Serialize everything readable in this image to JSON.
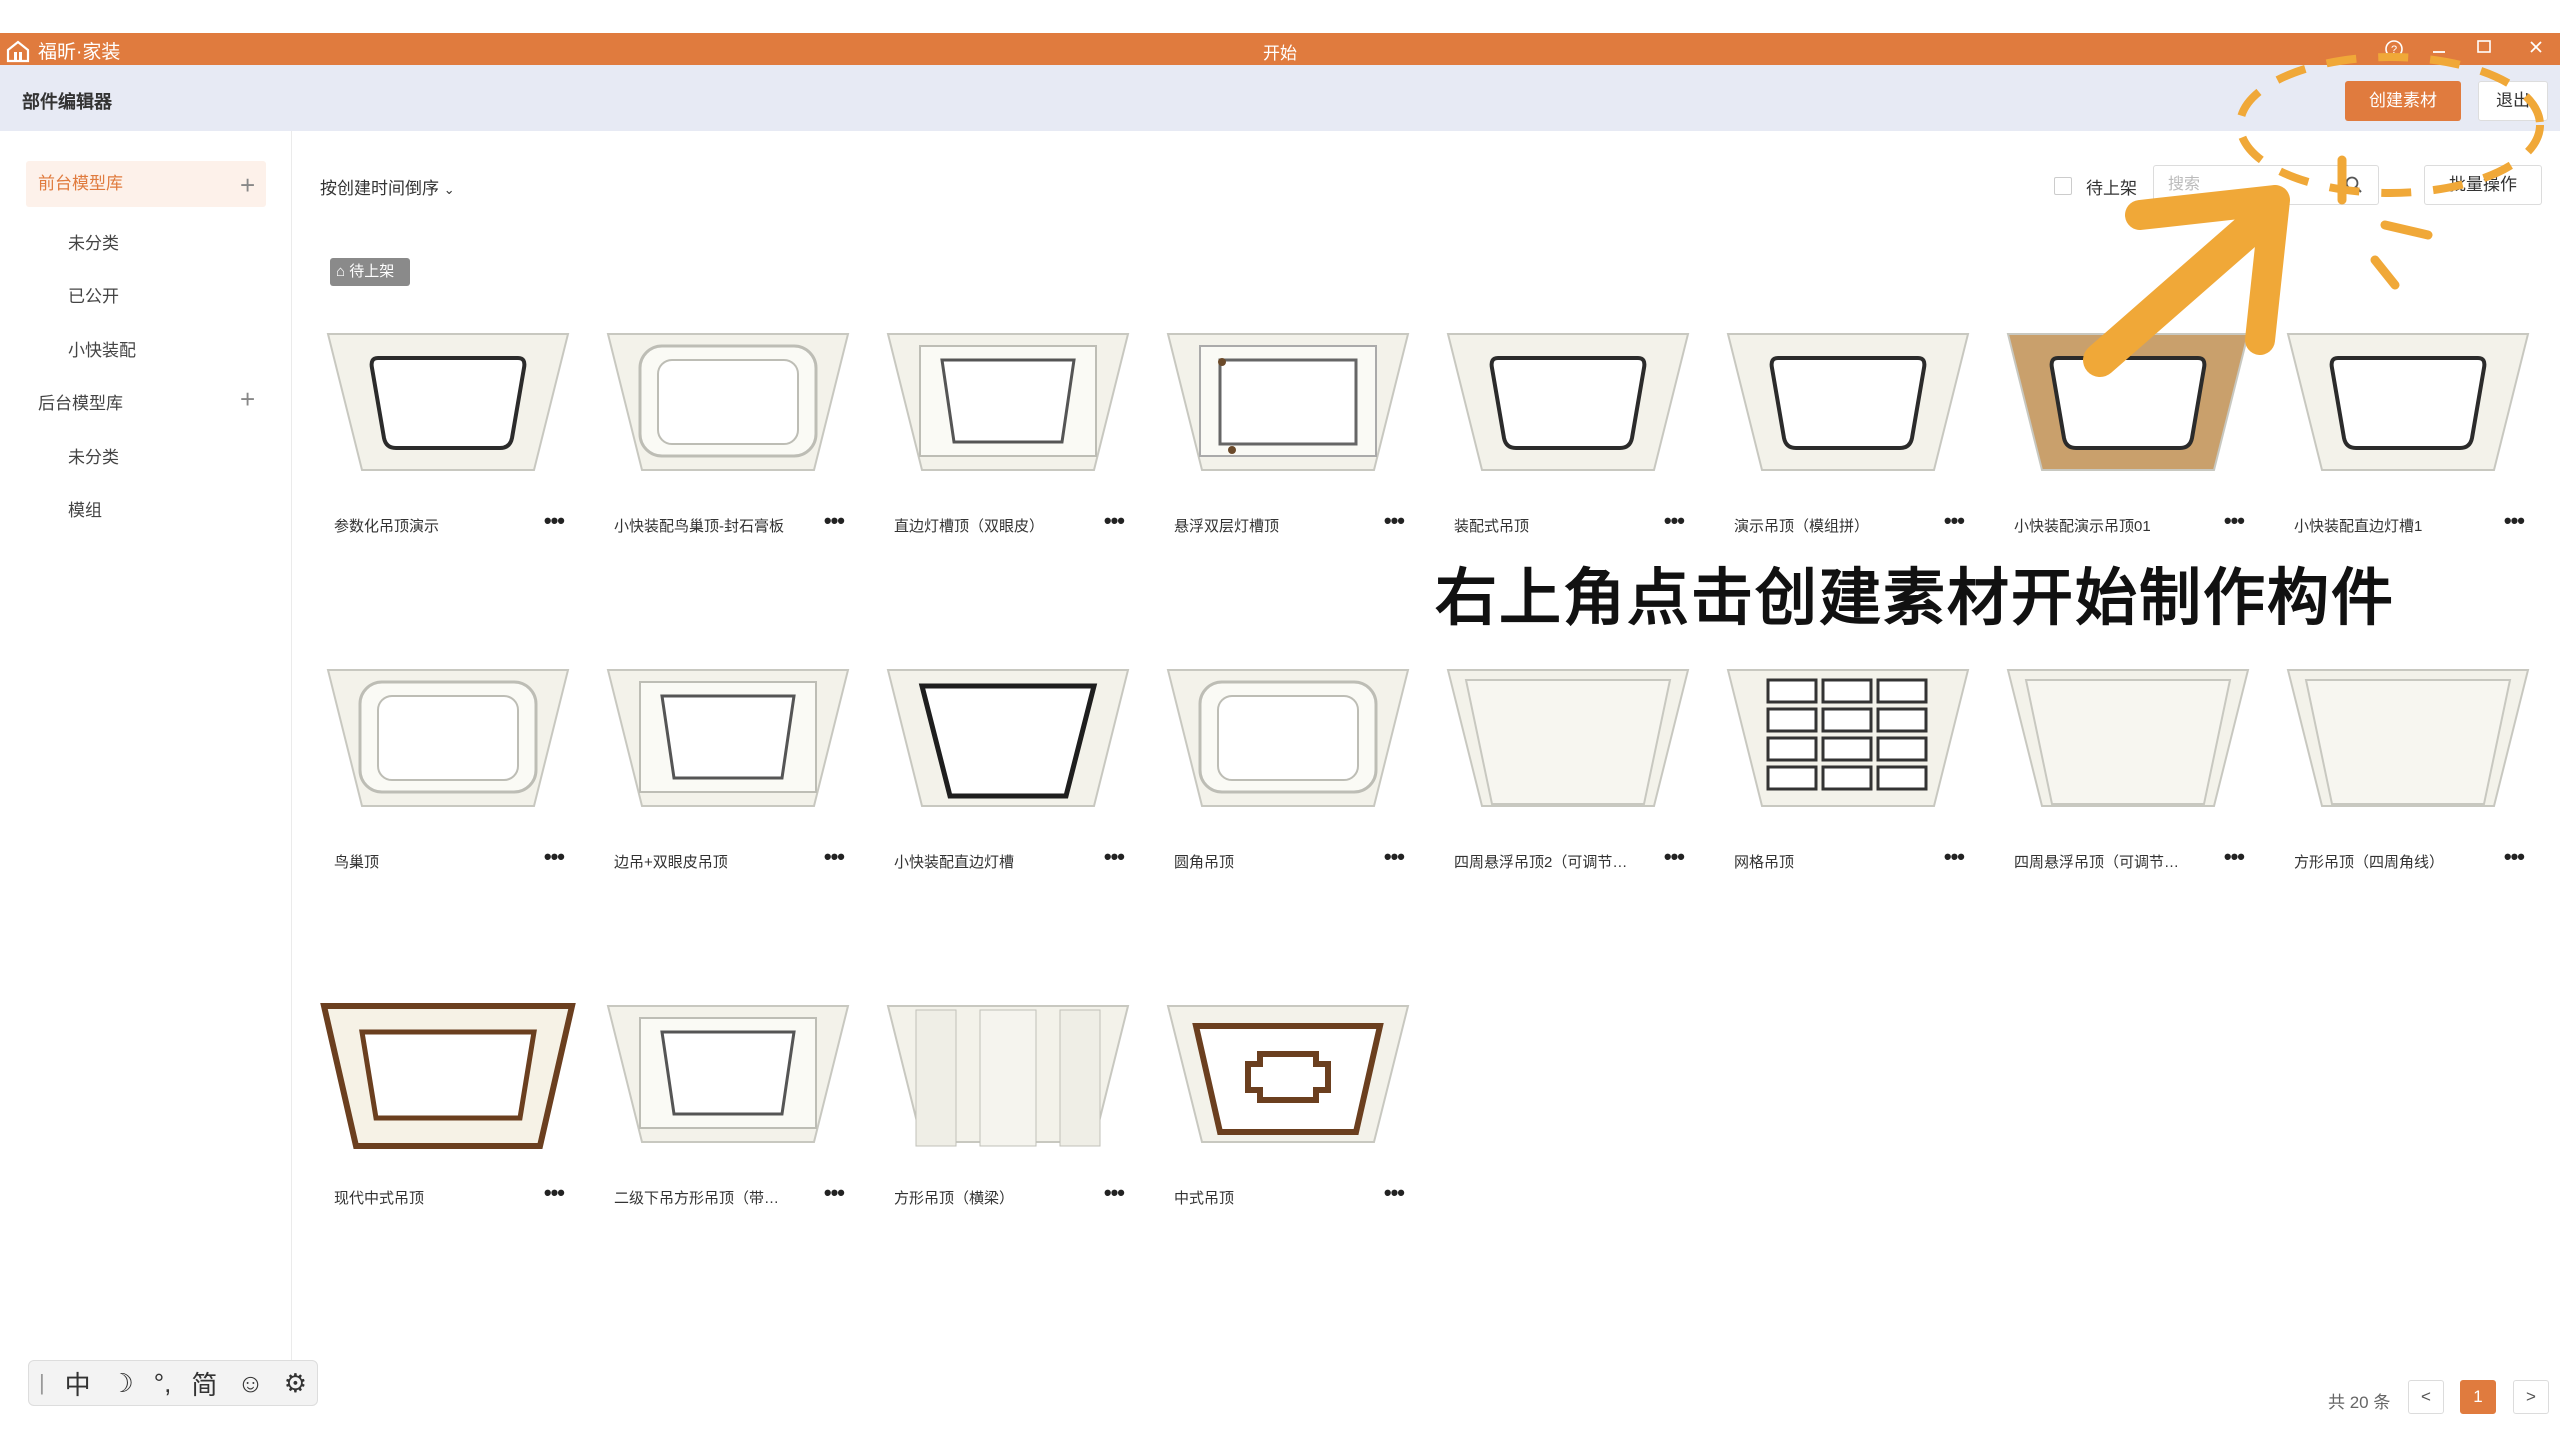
{
  "app": {
    "brand": "福昕·家装",
    "window_title": "开始"
  },
  "header": {
    "page_title": "部件编辑器",
    "create_label": "创建素材",
    "exit_label": "退出"
  },
  "sidebar": {
    "front_lib": "前台模型库",
    "front_items": [
      "未分类",
      "已公开",
      "小快装配"
    ],
    "back_lib": "后台模型库",
    "back_items": [
      "未分类",
      "模组"
    ]
  },
  "toolbar": {
    "sort_label": "按创建时间倒序",
    "pending_label": "待上架",
    "search_placeholder": "搜索",
    "batch_label": "批量操作"
  },
  "badge": "待上架",
  "cards": [
    "参数化吊顶演示",
    "小快装配鸟巢顶-封石膏板",
    "直边灯槽顶（双眼皮）",
    "悬浮双层灯槽顶",
    "装配式吊顶",
    "演示吊顶（模组拼）",
    "小快装配演示吊顶01",
    "小快装配直边灯槽1",
    "鸟巢顶",
    "边吊+双眼皮吊顶",
    "小快装配直边灯槽",
    "圆角吊顶",
    "四周悬浮吊顶2（可调节…",
    "网格吊顶",
    "四周悬浮吊顶（可调节…",
    "方形吊顶（四周角线）",
    "现代中式吊顶",
    "二级下吊方形吊顶（带…",
    "方形吊顶（横梁）",
    "中式吊顶"
  ],
  "more_label": "•••",
  "caption": "右上角点击创建素材开始制作构件",
  "ime": [
    "中",
    "简"
  ],
  "pagination": {
    "total": "共 20 条",
    "current": "1",
    "prev": "<",
    "next": ">"
  },
  "colors": {
    "accent": "#e07b3e",
    "header_bg": "#e7eaf4",
    "wood": "#c9a06c"
  }
}
